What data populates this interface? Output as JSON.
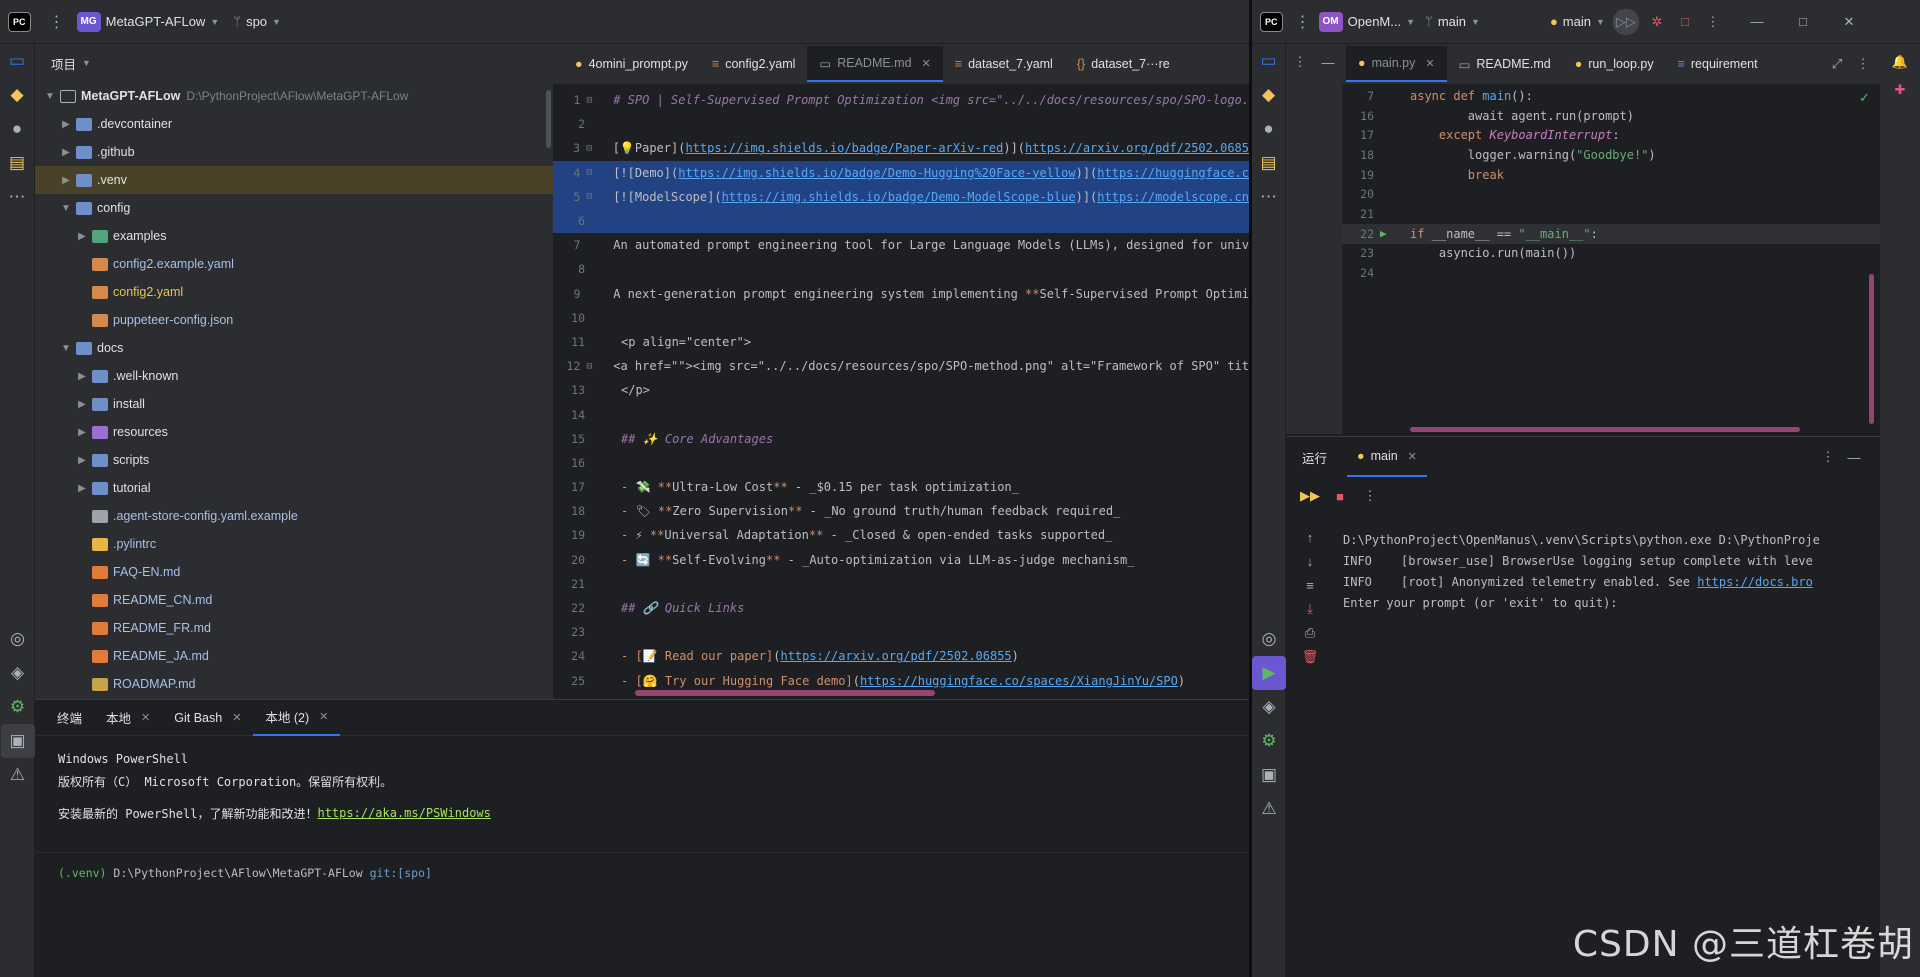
{
  "left_titlebar": {
    "app_badge": "PC",
    "project_badge": "MG",
    "project_name": "MetaGPT-AFLow",
    "branch": "spo"
  },
  "right_titlebar": {
    "app_badge": "PC",
    "project_badge": "OM",
    "project_name": "OpenM...",
    "branch": "main",
    "run_config": "main"
  },
  "project_panel": {
    "title": "项目",
    "root_name": "MetaGPT-AFLow",
    "root_path": "D:\\PythonProject\\AFlow\\MetaGPT-AFLow",
    "items": [
      {
        "label": ".devcontainer",
        "depth": 1,
        "arrow": "right",
        "kind": "folder"
      },
      {
        "label": ".github",
        "depth": 1,
        "arrow": "right",
        "kind": "folder"
      },
      {
        "label": ".venv",
        "depth": 1,
        "arrow": "right",
        "kind": "folder",
        "highlight": true
      },
      {
        "label": "config",
        "depth": 1,
        "arrow": "down",
        "kind": "folder"
      },
      {
        "label": "examples",
        "depth": 2,
        "arrow": "right",
        "kind": "folder-green"
      },
      {
        "label": "config2.example.yaml",
        "depth": 2,
        "arrow": "",
        "kind": "yaml"
      },
      {
        "label": "config2.yaml",
        "depth": 2,
        "arrow": "",
        "kind": "yaml",
        "modified": true
      },
      {
        "label": "puppeteer-config.json",
        "depth": 2,
        "arrow": "",
        "kind": "yaml"
      },
      {
        "label": "docs",
        "depth": 1,
        "arrow": "down",
        "kind": "folder"
      },
      {
        "label": ".well-known",
        "depth": 2,
        "arrow": "right",
        "kind": "folder"
      },
      {
        "label": "install",
        "depth": 2,
        "arrow": "right",
        "kind": "folder"
      },
      {
        "label": "resources",
        "depth": 2,
        "arrow": "right",
        "kind": "folder-purple"
      },
      {
        "label": "scripts",
        "depth": 2,
        "arrow": "right",
        "kind": "folder"
      },
      {
        "label": "tutorial",
        "depth": 2,
        "arrow": "right",
        "kind": "folder"
      },
      {
        "label": ".agent-store-config.yaml.example",
        "depth": 2,
        "arrow": "",
        "kind": "file"
      },
      {
        "label": ".pylintrc",
        "depth": 2,
        "arrow": "",
        "kind": "gear"
      },
      {
        "label": "FAQ-EN.md",
        "depth": 2,
        "arrow": "",
        "kind": "md"
      },
      {
        "label": "README_CN.md",
        "depth": 2,
        "arrow": "",
        "kind": "md"
      },
      {
        "label": "README_FR.md",
        "depth": 2,
        "arrow": "",
        "kind": "md"
      },
      {
        "label": "README_JA.md",
        "depth": 2,
        "arrow": "",
        "kind": "md"
      },
      {
        "label": "ROADMAP.md",
        "depth": 2,
        "arrow": "",
        "kind": "roadmap"
      }
    ]
  },
  "left_tabs": [
    {
      "label": "4omini_prompt.py",
      "kind": "py"
    },
    {
      "label": "config2.yaml",
      "kind": "yaml"
    },
    {
      "label": "README.md",
      "kind": "md",
      "active": true
    },
    {
      "label": "dataset_7.yaml",
      "kind": "yaml"
    },
    {
      "label": "dataset_7···re",
      "kind": "json"
    }
  ],
  "readme_lines": [
    {
      "n": "1",
      "html": "<span class='md-h'># SPO | Self-Supervised Prompt Optimization &lt;img src=\"../../docs/resources/spo/SPO-logo.</span>"
    },
    {
      "n": "2",
      "html": ""
    },
    {
      "n": "3",
      "html": "[💡Paper](<span class='md-url'>https://img.shields.io/badge/Paper-arXiv-red</span>)](<span class='md-url'>https://arxiv.org/pdf/2502.0685</span>"
    },
    {
      "n": "4",
      "html": "[![Demo](<span class='md-url'>https://img.shields.io/badge/Demo-Hugging%20Face-yellow</span>)](<span class='md-url'>https://huggingface.c</span>",
      "sel": true
    },
    {
      "n": "5",
      "html": "[![ModelScope](<span class='md-url'>https://img.shields.io/badge/Demo-ModelScope-blue</span>)](<span class='md-url'>https://modelscope.cn</span>",
      "sel": true
    },
    {
      "n": "6",
      "html": "",
      "sel": true
    },
    {
      "n": "7",
      "html": "An automated prompt engineering tool for Large Language Models (LLMs), designed for univ"
    },
    {
      "n": "8",
      "html": ""
    },
    {
      "n": "9",
      "html": "A next-generation prompt engineering system implementing <span class='md-bold'>**</span>Self-Supervised Prompt Optimi"
    },
    {
      "n": "10",
      "html": ""
    },
    {
      "n": "11",
      "html": "&lt;p align=\"center\"&gt;"
    },
    {
      "n": "12",
      "html": "&lt;a href=\"\"&gt;&lt;img src=\"../../docs/resources/spo/SPO-method.png\" alt=\"Framework of SPO\" tit"
    },
    {
      "n": "13",
      "html": "&lt;/p&gt;"
    },
    {
      "n": "14",
      "html": ""
    },
    {
      "n": "15",
      "html": "<span class='md-h'>## ✨ Core Advantages</span>"
    },
    {
      "n": "16",
      "html": ""
    },
    {
      "n": "17",
      "html": "<span class='md-bold'>-</span> 💸 <span class='md-bold'>**</span>Ultra-Low Cost<span class='md-bold'>**</span> - _$0.15 per task optimization_"
    },
    {
      "n": "18",
      "html": "<span class='md-bold'>-</span> 🏷 <span class='md-bold'>**</span>Zero Supervision<span class='md-bold'>**</span> - _No ground truth/human feedback required_"
    },
    {
      "n": "19",
      "html": "<span class='md-bold'>-</span> ⚡ <span class='md-bold'>**</span>Universal Adaptation<span class='md-bold'>**</span> - _Closed &amp; open-ended tasks supported_"
    },
    {
      "n": "20",
      "html": "<span class='md-bold'>-</span> 🔄 <span class='md-bold'>**</span>Self-Evolving<span class='md-bold'>**</span> - _Auto-optimization via LLM-as-judge mechanism_"
    },
    {
      "n": "21",
      "html": ""
    },
    {
      "n": "22",
      "html": "<span class='md-h'>## 🔗 Quick Links</span>"
    },
    {
      "n": "23",
      "html": ""
    },
    {
      "n": "24",
      "html": "<span class='md-bold'>-</span> <span class='md-bold'>[📝 Read our paper]</span>(<span class='md-url'>https://arxiv.org/pdf/2502.06855</span>)"
    },
    {
      "n": "25",
      "html": "<span class='md-bold'>-</span> <span class='md-bold'>[🤗 Try our Hugging Face demo]</span>(<span class='md-url'>https://huggingface.co/spaces/XiangJinYu/SPO</span>)"
    },
    {
      "n": "26",
      "html": ""
    }
  ],
  "terminal": {
    "tabs": [
      {
        "label": "终端",
        "closable": false
      },
      {
        "label": "本地",
        "closable": true
      },
      {
        "label": "Git Bash",
        "closable": true
      },
      {
        "label": "本地 (2)",
        "closable": true,
        "active": true
      }
    ],
    "line1": "Windows PowerShell",
    "line2": "版权所有（C） Microsoft Corporation。保留所有权利。",
    "line3_prefix": "安装最新的 PowerShell，了解新功能和改进！",
    "line3_link": "https://aka.ms/PSWindows",
    "prompt_venv": "(.venv)",
    "prompt_path": "D:\\PythonProject\\AFlow\\MetaGPT-AFLow",
    "prompt_git": "git:[spo]"
  },
  "right_tabs": [
    {
      "label": "main.py",
      "kind": "py",
      "active": true
    },
    {
      "label": "README.md",
      "kind": "md"
    },
    {
      "label": "run_loop.py",
      "kind": "py"
    },
    {
      "label": "requirement",
      "kind": "req"
    }
  ],
  "right_code": [
    {
      "n": "7",
      "html": "<span class='kw'>async def</span> <span class='fn'>main</span>():"
    },
    {
      "n": "16",
      "html": "        <span style='color:#bcbec4'>await agent.run(prompt)</span>"
    },
    {
      "n": "17",
      "html": "    <span class='kw'>except</span> <span class='cls'>KeyboardInterrupt</span>:"
    },
    {
      "n": "18",
      "html": "        logger.warning(<span class='str'>\"Goodbye!\"</span>)"
    },
    {
      "n": "19",
      "html": "        <span class='kw'>break</span>"
    },
    {
      "n": "20",
      "html": ""
    },
    {
      "n": "21",
      "html": ""
    },
    {
      "n": "22",
      "html": "<span class='kw'>if</span> __name__ == <span class='str'>\"__main__\"</span>:",
      "run": true
    },
    {
      "n": "23",
      "html": "    asyncio.run(main())"
    },
    {
      "n": "24",
      "html": ""
    }
  ],
  "run_panel": {
    "title": "运行",
    "tab": "main",
    "line1": "D:\\PythonProject\\OpenManus\\.venv\\Scripts\\python.exe D:\\PythonProje",
    "line2_level": "INFO",
    "line2_text": "[browser_use] BrowserUse logging setup complete with leve",
    "line3_level": "INFO",
    "line3_text": "[root] Anonymized telemetry enabled. See ",
    "line3_link": "https://docs.bro",
    "line4": "Enter your prompt (or 'exit' to quit):"
  },
  "watermark": "CSDN @三道杠卷胡",
  "colors": {
    "accent": "#3574f0",
    "selection": "#214283",
    "highlight_row": "#4a4228"
  }
}
